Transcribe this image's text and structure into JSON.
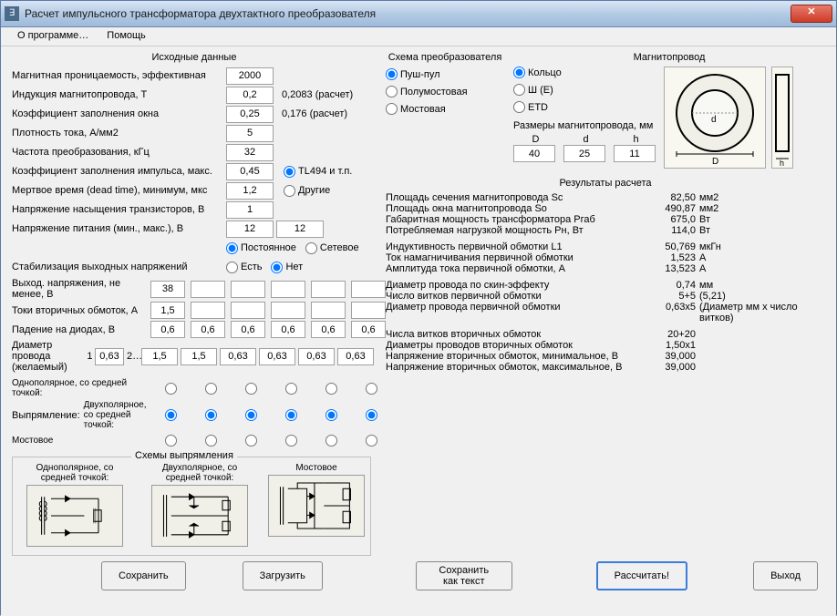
{
  "window": {
    "title": "Расчет импульсного трансформатора двухтактного преобразователя"
  },
  "menu": {
    "about": "О программе…",
    "help": "Помощь"
  },
  "input": {
    "heading": "Исходные данные",
    "perm_label": "Магнитная проницаемость, эффективная",
    "perm_val": "2000",
    "induction_label": "Индукция магнитопровода, Т",
    "induction_val": "0,2",
    "induction_calc": "0,2083 (расчет)",
    "fillwin_label": "Коэффициент заполнения окна",
    "fillwin_val": "0,25",
    "fillwin_calc": "0,176 (расчет)",
    "density_label": "Плотность тока, А/мм2",
    "density_val": "5",
    "freq_label": "Частота преобразования, кГц",
    "freq_val": "32",
    "duty_label": "Коэффициент заполнения импульса, макс.",
    "duty_val": "0,45",
    "duty_opt1": "TL494 и т.п.",
    "duty_opt2": "Другие",
    "dead_label": "Мертвое время (dead time), минимум, мкс",
    "dead_val": "1,2",
    "vsat_label": "Напряжение насыщения транзисторов, В",
    "vsat_val": "1",
    "vin_label": "Напряжение питания (мин., макс.), В",
    "vin_min": "12",
    "vin_max": "12",
    "supply_opt1": "Постоянное",
    "supply_opt2": "Сетевое",
    "stab_label": "Стабилизация выходных напряжений",
    "stab_opt1": "Есть",
    "stab_opt2": "Нет",
    "vout_label": "Выход. напряжения, не менее, В",
    "vout_vals": [
      "38",
      "",
      "",
      "",
      "",
      ""
    ],
    "iout_label": "Токи вторичных обмоток, А",
    "iout_vals": [
      "1,5",
      "",
      "",
      "",
      "",
      ""
    ],
    "vdrop_label": "Падение на диодах, В",
    "vdrop_vals": [
      "0,6",
      "0,6",
      "0,6",
      "0,6",
      "0,6",
      "0,6"
    ],
    "wire_label": "Диаметр провода (желаемый)",
    "wire_prefix": "1",
    "wire_prefix2": "0,63",
    "wire_extra": "2…",
    "wire_vals": [
      "1,5",
      "1,5",
      "0,63",
      "0,63",
      "0,63",
      "0,63"
    ],
    "rect_heading": "Выпрямление:",
    "rect_opt1": "Однополярное, со средней точкой:",
    "rect_opt2": "Двухполярное, со средней точкой:",
    "rect_opt3": "Мостовое"
  },
  "schemes": {
    "heading": "Схемы выпрямления",
    "c1": "Однополярное, со средней точкой:",
    "c2": "Двухполярное, со средней точкой:",
    "c3": "Мостовое"
  },
  "topbox": {
    "conv_heading": "Схема преобразователя",
    "conv_opt1": "Пуш-пул",
    "conv_opt2": "Полумостовая",
    "conv_opt3": "Мостовая",
    "core_heading": "Магнитопровод",
    "core_opt1": "Кольцо",
    "core_opt2": "Ш (E)",
    "core_opt3": "ETD",
    "dims_heading": "Размеры магнитопровода, мм",
    "D_label": "D",
    "D_val": "40",
    "d_label": "d",
    "d_val": "25",
    "h_label": "h",
    "h_val": "11"
  },
  "results": {
    "heading": "Результаты расчета",
    "r1l": "Площадь сечения магнитопровода Sc",
    "r1v": "82,50",
    "r1u": "мм2",
    "r2l": "Площадь окна магнитопровода So",
    "r2v": "490,87",
    "r2u": "мм2",
    "r3l": "Габаритная мощность трансформатора Pгаб",
    "r3v": "675,0",
    "r3u": "Вт",
    "r4l": "Потребляемая нагрузкой мощность Pн, Вт",
    "r4v": "114,0",
    "r4u": "Вт",
    "r5l": "Индуктивность первичной обмотки L1",
    "r5v": "50,769",
    "r5u": "мкГн",
    "r6l": "Ток намагничивания первичной обмотки",
    "r6v": "1,523",
    "r6u": "А",
    "r7l": "Амплитуда тока первичной обмотки, А",
    "r7v": "13,523",
    "r7u": "А",
    "r8l": "Диаметр провода по скин-эффекту",
    "r8v": "0,74",
    "r8u": "мм",
    "r9l": "Число витков первичной обмотки",
    "r9v": "5+5",
    "r9e": "(5,21)",
    "r10l": "Диаметр провода первичной обмотки",
    "r10v": "0,63x5",
    "r10e": "(Диаметр мм x число витков)",
    "r11l": "Числа витков вторичных обмоток",
    "r11v": "20+20",
    "r12l": "Диаметры проводов вторичных обмоток",
    "r12v": "1,50x1",
    "r13l": "Напряжение вторичных обмоток, минимальное, В",
    "r13v": "39,000",
    "r14l": "Напряжение вторичных обмоток, максимальное, В",
    "r14v": "39,000"
  },
  "buttons": {
    "save": "Сохранить",
    "load": "Загрузить",
    "savetext": "Сохранить как текст",
    "calc": "Рассчитать!",
    "exit": "Выход"
  }
}
